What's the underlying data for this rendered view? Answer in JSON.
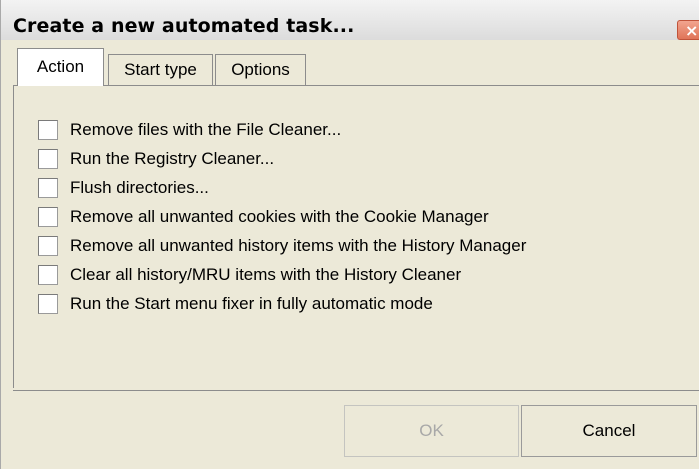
{
  "window": {
    "title": "Create a new automated task...",
    "close_glyph": "×"
  },
  "tabs": [
    {
      "label": "Action",
      "active": true
    },
    {
      "label": "Start type",
      "active": false
    },
    {
      "label": "Options",
      "active": false
    }
  ],
  "options": [
    {
      "label": "Remove files with the File Cleaner...",
      "checked": false
    },
    {
      "label": "Run the Registry Cleaner...",
      "checked": false
    },
    {
      "label": "Flush directories...",
      "checked": false
    },
    {
      "label": "Remove all unwanted cookies with the Cookie Manager",
      "checked": false
    },
    {
      "label": "Remove all unwanted history items with the History Manager",
      "checked": false
    },
    {
      "label": "Clear all history/MRU items with the History Cleaner",
      "checked": false
    },
    {
      "label": "Run the Start menu fixer in fully automatic mode",
      "checked": false
    }
  ],
  "buttons": {
    "ok_label": "OK",
    "ok_enabled": false,
    "cancel_label": "Cancel"
  }
}
